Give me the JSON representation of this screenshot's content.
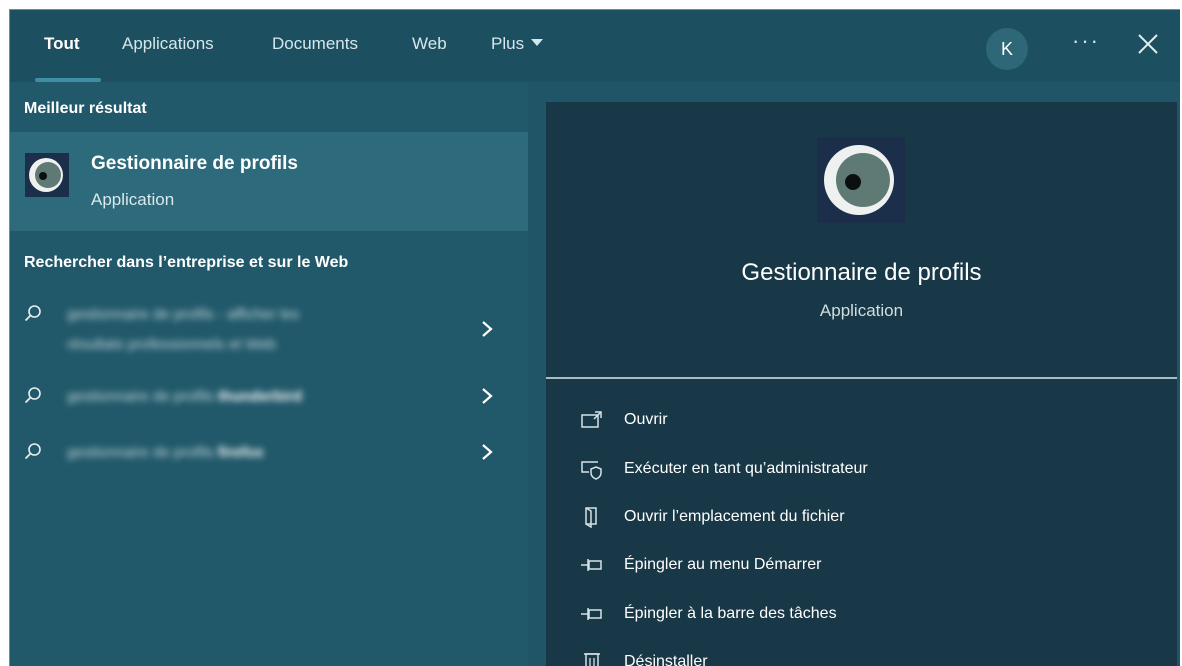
{
  "tabs": [
    {
      "label": "Tout",
      "active": true
    },
    {
      "label": "Applications"
    },
    {
      "label": "Documents"
    },
    {
      "label": "Web"
    },
    {
      "label": "Plus"
    }
  ],
  "header": {
    "avatar_letter": "K",
    "more_label": "···"
  },
  "best_match": {
    "heading": "Meilleur résultat",
    "name": "Gestionnaire de profils",
    "type": "Application"
  },
  "web_search": {
    "heading": "Rechercher dans l’entreprise et sur le Web",
    "items": [
      {
        "text_line1": "gestionnaire de profils",
        "suffix_line1": " - afficher les",
        "text_line2": "résultats professionnels et Web"
      },
      {
        "text_line1": "gestionnaire de profils",
        "suffix_line1": " thunderbird"
      },
      {
        "text_line1": "gestionnaire de profils",
        "suffix_line1": " firefox"
      }
    ]
  },
  "details": {
    "name": "Gestionnaire de profils",
    "type": "Application",
    "actions": [
      {
        "label": "Ouvrir",
        "icon": "open-icon"
      },
      {
        "label": "Exécuter en tant qu’administrateur",
        "icon": "shield-run-icon"
      },
      {
        "label": "Ouvrir l’emplacement du fichier",
        "icon": "file-location-icon"
      },
      {
        "label": "Épingler au menu Démarrer",
        "icon": "pin-icon"
      },
      {
        "label": "Épingler à la barre des tâches",
        "icon": "pin-icon"
      },
      {
        "label": "Désinstaller",
        "icon": "trash-icon"
      }
    ]
  },
  "colors": {
    "background": "#1f5566",
    "selected": "#2c6a7c",
    "detail_panel": "#183847",
    "accent": "#3f8ea3"
  }
}
